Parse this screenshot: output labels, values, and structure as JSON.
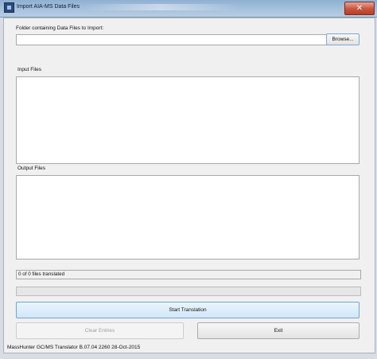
{
  "window": {
    "title": "Import AIA-MS Data Files",
    "close_glyph": "✕",
    "icon": "app-icon"
  },
  "folder": {
    "label": "Folder containing Data Files to Import:",
    "value": "",
    "browse_label": "Browse..."
  },
  "input_files": {
    "label": "Input Files"
  },
  "output_files": {
    "label": "Output Files"
  },
  "status": {
    "text": "0 of 0 files translated"
  },
  "progress": {
    "fraction": 0
  },
  "buttons": {
    "start": "Start Translation",
    "clear": "Clear Entries",
    "exit": "Exit"
  },
  "footer": {
    "version": "MassHunter GC/MS Translator B.07.04 2260 28-Oct-2015"
  }
}
